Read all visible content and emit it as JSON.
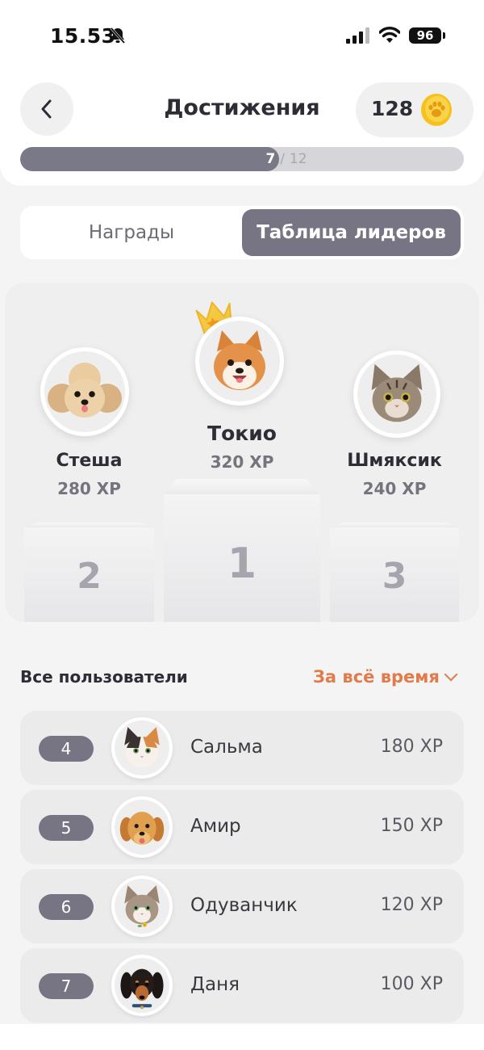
{
  "status_bar": {
    "time": "15.53",
    "battery": "96"
  },
  "header": {
    "title": "Достижения",
    "coins": "128",
    "progress": {
      "current": "7",
      "separator": "/",
      "total": "12",
      "fraction": 0.5833
    }
  },
  "tabs": [
    {
      "label": "Награды",
      "active": false
    },
    {
      "label": "Таблица лидеров",
      "active": true
    }
  ],
  "podium": {
    "first": {
      "name": "Токио",
      "xp": "320 XP",
      "place": "1"
    },
    "second": {
      "name": "Стеша",
      "xp": "280 XP",
      "place": "2"
    },
    "third": {
      "name": "Шмяксик",
      "xp": "240 XP",
      "place": "3"
    }
  },
  "all_users": {
    "title": "Все пользователи",
    "period": "За всё время",
    "items": [
      {
        "rank": "4",
        "name": "Сальма",
        "xp": "180 XP"
      },
      {
        "rank": "5",
        "name": "Амир",
        "xp": "150 XP"
      },
      {
        "rank": "6",
        "name": "Одуванчик",
        "xp": "120 XP"
      },
      {
        "rank": "7",
        "name": "Даня",
        "xp": "100 XP"
      }
    ]
  },
  "icons": [
    "mute-icon",
    "signal-icon",
    "wifi-icon",
    "back-arrow-icon",
    "paw-coin-icon",
    "crown-icon",
    "chevron-down-icon"
  ],
  "colors": {
    "accent": "#777584",
    "orange": "#e07b4b",
    "coin": "#f4b400"
  }
}
